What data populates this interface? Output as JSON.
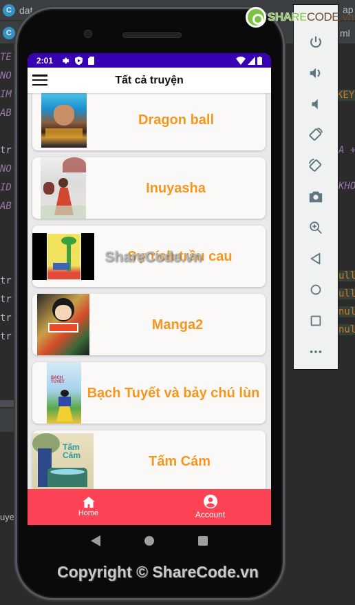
{
  "ide": {
    "tabs": [
      {
        "icon": "class-icon",
        "label": "dat"
      },
      {
        "icon": "class-icon",
        "label": ""
      }
    ],
    "right_tab_labels": [
      "ap",
      "ml"
    ],
    "left_code_lines": [
      "TE",
      "NO",
      "IM",
      "AB",
      "",
      "tr",
      "NO",
      "ID",
      "AB",
      "",
      "",
      "",
      "tr",
      "tr",
      "tr",
      "tr"
    ],
    "right_code_lines": [
      "KEY",
      "A +",
      "KHO",
      "ull",
      "ull",
      "nul",
      "nul"
    ],
    "left_bottom_fragment": "uye"
  },
  "logo": {
    "part1": "SHARE",
    "part2": "CODE.vn"
  },
  "statusbar": {
    "time": "2:01",
    "icons": [
      "gear-icon",
      "shield-play-icon",
      "sd-card-icon"
    ],
    "right_icons": [
      "wifi-icon",
      "signal-icon",
      "battery-icon"
    ]
  },
  "appbar": {
    "menu_icon": "hamburger-menu-icon",
    "title": "Tất cả truyện"
  },
  "stories": [
    {
      "title": "Dragon ball",
      "cover": "dragon-ball-cover"
    },
    {
      "title": "Inuyasha",
      "cover": "inuyasha-cover"
    },
    {
      "title": "Sự tích trầu cau",
      "cover": "su-tich-trau-cau-cover"
    },
    {
      "title": "Manga2",
      "cover": "manga2-cover"
    },
    {
      "title": "Bạch Tuyết và bảy chú lùn",
      "cover": "bach-tuyet-cover"
    },
    {
      "title": "Tấm Cám",
      "cover": "tam-cam-cover"
    }
  ],
  "bottom_nav": [
    {
      "label": "Home",
      "icon": "home-icon"
    },
    {
      "label": "Account",
      "icon": "account-circle-icon"
    }
  ],
  "system_nav": [
    "back-icon",
    "home-circle-icon",
    "recents-icon"
  ],
  "emulator_toolbar": [
    {
      "icon": "power-icon"
    },
    {
      "icon": "volume-up-icon"
    },
    {
      "icon": "volume-down-icon"
    },
    {
      "icon": "rotate-left-icon"
    },
    {
      "icon": "rotate-right-icon"
    },
    {
      "icon": "camera-icon"
    },
    {
      "icon": "zoom-in-icon"
    },
    {
      "icon": "back-triangle-icon"
    },
    {
      "icon": "home-circle-icon"
    },
    {
      "icon": "overview-square-icon"
    },
    {
      "icon": "more-icon"
    }
  ],
  "watermarks": {
    "center": "ShareCode.vn",
    "footer": "Copyright © ShareCode.vn"
  },
  "colors": {
    "statusbar": "#3700b3",
    "accent_title": "#f5961e",
    "bottom_nav": "#fe4356",
    "card_bg": "#faf9f8",
    "list_bg": "#e9e9eb"
  }
}
